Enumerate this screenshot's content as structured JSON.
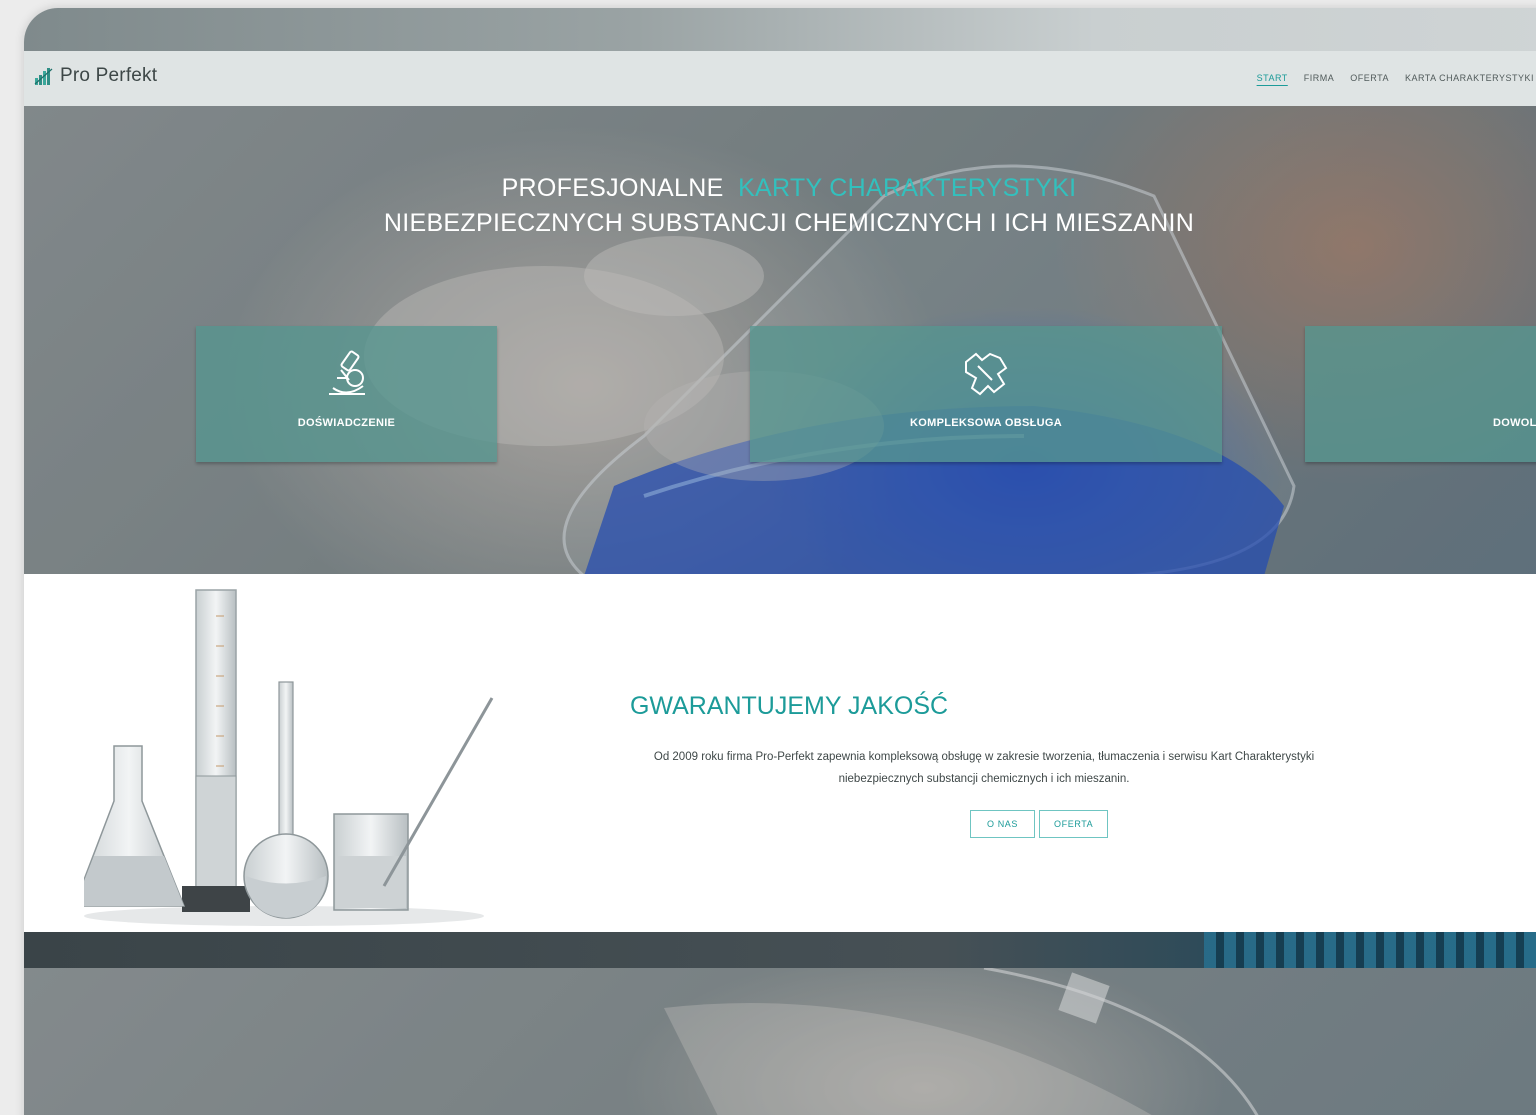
{
  "header": {
    "logo_text": "Pro Perfekt",
    "nav": [
      {
        "label": "START",
        "active": true
      },
      {
        "label": "FIRMA",
        "active": false
      },
      {
        "label": "OFERTA",
        "active": false
      },
      {
        "label": "KARTA CHARAKTERYSTYKI",
        "active": false
      }
    ]
  },
  "hero": {
    "title_prefix": "PROFESJONALNE",
    "title_accent": "KARTY CHARAKTERYSTYKI",
    "title_line2": "NIEBEZPIECZNYCH SUBSTANCJI CHEMICZNYCH I ICH MIESZANIN",
    "cards": [
      {
        "label": "DOŚWIADCZENIE",
        "icon": "microscope-icon"
      },
      {
        "label": "KOMPLEKSOWA OBSŁUGA",
        "icon": "europe-map-icon"
      },
      {
        "label": "DOWOLNY",
        "icon": "globe-icon"
      }
    ]
  },
  "quality": {
    "title": "GWARANTUJEMY JAKOŚĆ",
    "text": "Od 2009 roku firma Pro-Perfekt zapewnia kompleksową obsługę w zakresie tworzenia, tłumaczenia i serwisu Kart Charakterystyki niebezpiecznych substancji chemicznych i ich mieszanin.",
    "buttons": [
      "O NAS",
      "OFERTA"
    ]
  },
  "colors": {
    "accent": "#1c9b99",
    "card": "#56968f"
  }
}
